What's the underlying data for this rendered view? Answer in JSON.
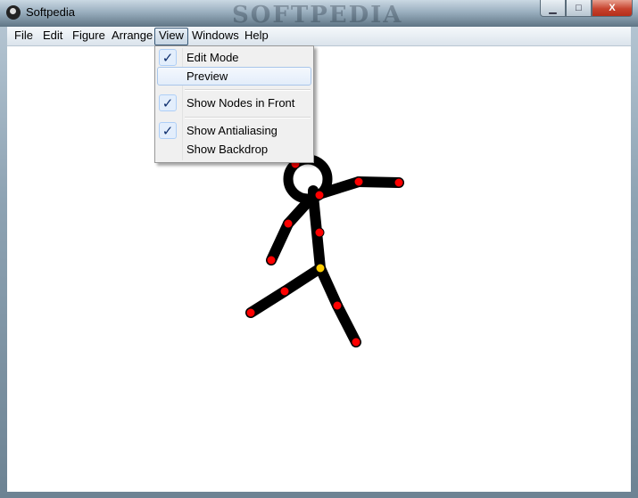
{
  "window": {
    "title": "Softpedia",
    "watermark": "SOFTPEDIA",
    "buttons": {
      "minimize": "▁",
      "maximize": "□",
      "close": "X"
    }
  },
  "menubar": [
    "File",
    "Edit",
    "Figure",
    "Arrange",
    "View",
    "Windows",
    "Help"
  ],
  "view_menu": {
    "items": [
      {
        "label": "Edit Mode",
        "checked": true
      },
      {
        "label": "Preview",
        "checked": false,
        "highlighted": true
      },
      {
        "label": "Show Nodes in Front",
        "checked": true
      },
      {
        "label": "Show Antialiasing",
        "checked": true
      },
      {
        "label": "Show Backdrop",
        "checked": false
      }
    ],
    "check_glyph": "✓"
  },
  "colors": {
    "limb": "#000000",
    "node": "#ff0000",
    "root_node": "#ffcc00",
    "canvas": "#ffffff"
  }
}
